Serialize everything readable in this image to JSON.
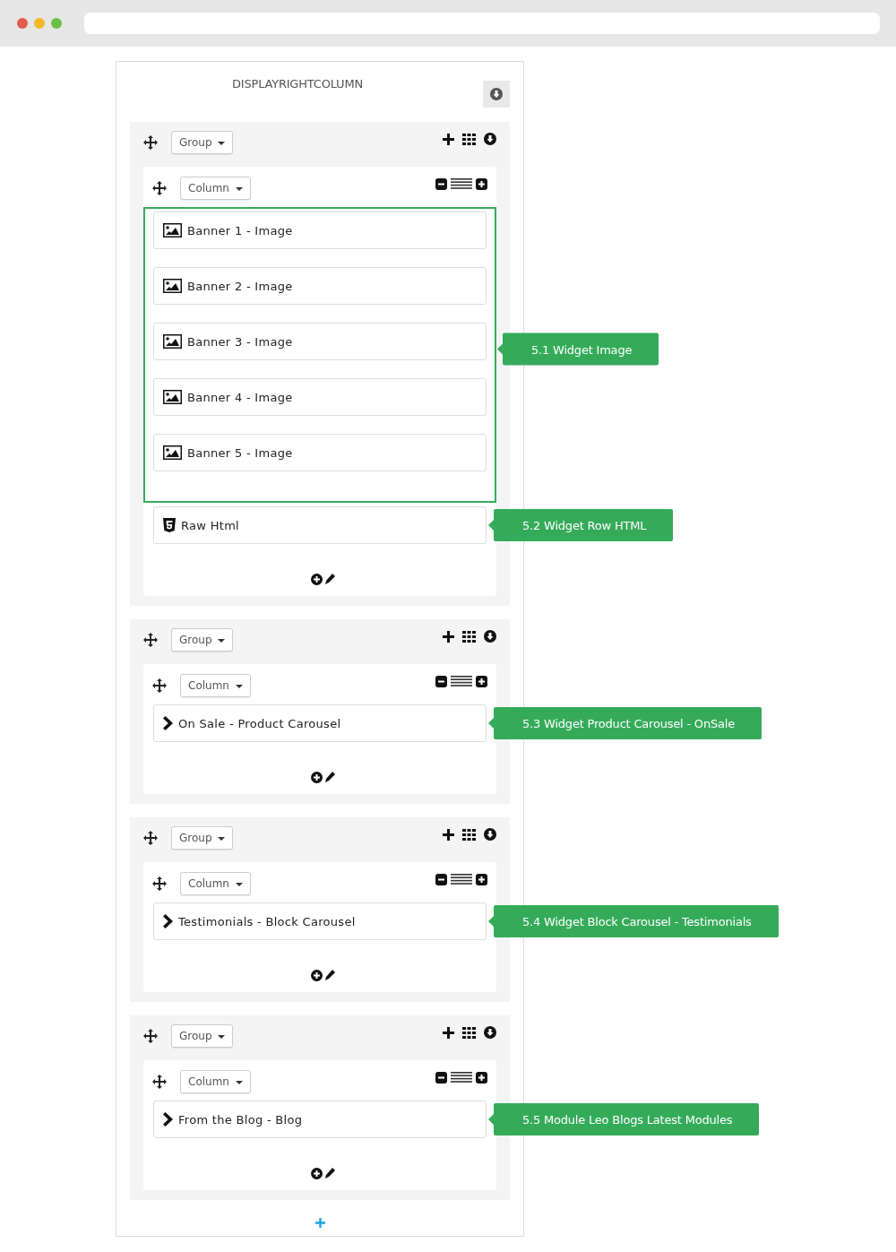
{
  "position_title": "DISPLAYRIGHTCOLUMN",
  "groups": [
    {
      "group_label": "Group",
      "column_label": "Column",
      "sections": [
        {
          "highlighted": true,
          "callout": "5.1 Widget Image",
          "widgets": [
            {
              "kind": "image",
              "label": "Banner 1 - Image"
            },
            {
              "kind": "image",
              "label": "Banner 2 - Image"
            },
            {
              "kind": "image",
              "label": "Banner 3 - Image"
            },
            {
              "kind": "image",
              "label": "Banner 4 - Image"
            },
            {
              "kind": "image",
              "label": "Banner 5 - Image"
            }
          ]
        },
        {
          "highlighted": false,
          "callout": "5.2 Widget Row HTML",
          "widgets": [
            {
              "kind": "html",
              "label": "Raw Html"
            }
          ]
        }
      ]
    },
    {
      "group_label": "Group",
      "column_label": "Column",
      "sections": [
        {
          "highlighted": false,
          "callout": "5.3 Widget Product Carousel - OnSale",
          "widgets": [
            {
              "kind": "module",
              "label": "On Sale - Product Carousel"
            }
          ]
        }
      ]
    },
    {
      "group_label": "Group",
      "column_label": "Column",
      "sections": [
        {
          "highlighted": false,
          "callout": "5.4 Widget Block Carousel - Testimonials",
          "widgets": [
            {
              "kind": "module",
              "label": "Testimonials - Block Carousel"
            }
          ]
        }
      ]
    },
    {
      "group_label": "Group",
      "column_label": "Column",
      "sections": [
        {
          "highlighted": false,
          "callout": "5.5 Module Leo Blogs Latest Modules",
          "widgets": [
            {
              "kind": "module",
              "label": "From the Blog - Blog"
            }
          ]
        }
      ]
    }
  ]
}
